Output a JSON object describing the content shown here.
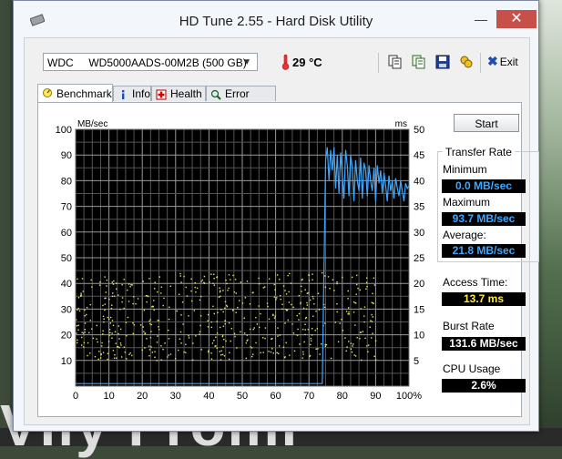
{
  "window": {
    "title": "HD Tune 2.55 - Hard Disk Utility",
    "minimize": "—",
    "close": "✕"
  },
  "toolbar": {
    "drive": "WDC     WD5000AADS-00M2B (500 GB)",
    "temperature": "29 °C",
    "exit_label": "Exit"
  },
  "tabs": [
    {
      "label": "Benchmark",
      "active": true
    },
    {
      "label": "Info",
      "active": false
    },
    {
      "label": "Health",
      "active": false
    },
    {
      "label": "Error Scan",
      "active": false
    }
  ],
  "start_label": "Start",
  "transfer_rate": {
    "title": "Transfer Rate",
    "minimum_label": "Minimum",
    "minimum": "0.0 MB/sec",
    "maximum_label": "Maximum",
    "maximum": "93.7 MB/sec",
    "average_label": "Average:",
    "average": "21.8 MB/sec"
  },
  "access_time": {
    "label": "Access Time:",
    "value": "13.7 ms"
  },
  "burst_rate": {
    "label": "Burst Rate",
    "value": "131.6 MB/sec"
  },
  "cpu_usage": {
    "label": "CPU Usage",
    "value": "2.6%"
  },
  "background_text": "Vily  Fromi",
  "chart_data": {
    "type": "line",
    "ylabel_left": "MB/sec",
    "ylabel_right": "ms",
    "ylim_left": [
      0,
      100
    ],
    "ylim_right": [
      0,
      50
    ],
    "xlim": [
      0,
      100
    ],
    "x_ticks": [
      "0",
      "10",
      "20",
      "30",
      "40",
      "50",
      "60",
      "70",
      "80",
      "90",
      "100%"
    ],
    "y_ticks_left": [
      "10",
      "20",
      "30",
      "40",
      "50",
      "60",
      "70",
      "80",
      "90",
      "100"
    ],
    "y_ticks_right": [
      "5",
      "10",
      "15",
      "20",
      "25",
      "30",
      "35",
      "40",
      "45",
      "50"
    ],
    "grid": true,
    "series": [
      {
        "series_kind": "transfer rate (MB/sec)",
        "color": "#3ea7ff",
        "x": [
          0,
          10,
          20,
          30,
          40,
          50,
          60,
          70,
          74,
          75,
          75.5,
          76,
          76.5,
          77,
          77.5,
          78,
          78.5,
          79,
          79.5,
          80,
          80.5,
          81,
          81.5,
          82,
          82.5,
          83,
          83.5,
          84,
          84.5,
          85,
          85.5,
          86,
          86.5,
          87,
          87.5,
          88,
          88.5,
          89,
          89.5,
          90,
          90.5,
          91,
          91.5,
          92,
          92.5,
          93,
          93.5,
          94,
          94.5,
          95,
          95.5,
          96,
          96.5,
          97,
          97.5,
          98,
          98.5,
          99,
          99.5,
          100
        ],
        "y": [
          1,
          1,
          1,
          1,
          1,
          1,
          1,
          1,
          1,
          88,
          93,
          80,
          92,
          84,
          93,
          77,
          90,
          75,
          91,
          82,
          73,
          92,
          86,
          74,
          90,
          85,
          72,
          88,
          80,
          76,
          89,
          73,
          87,
          84,
          74,
          86,
          80,
          76,
          85,
          72,
          86,
          79,
          84,
          75,
          83,
          78,
          72,
          82,
          76,
          80,
          73,
          81,
          77,
          74,
          80,
          76,
          72,
          79,
          77,
          78
        ]
      },
      {
        "series_kind": "access time (ms, scatter)",
        "color": "#e8e866",
        "x_range": [
          0,
          90
        ],
        "y_range": [
          5,
          22
        ]
      }
    ]
  }
}
